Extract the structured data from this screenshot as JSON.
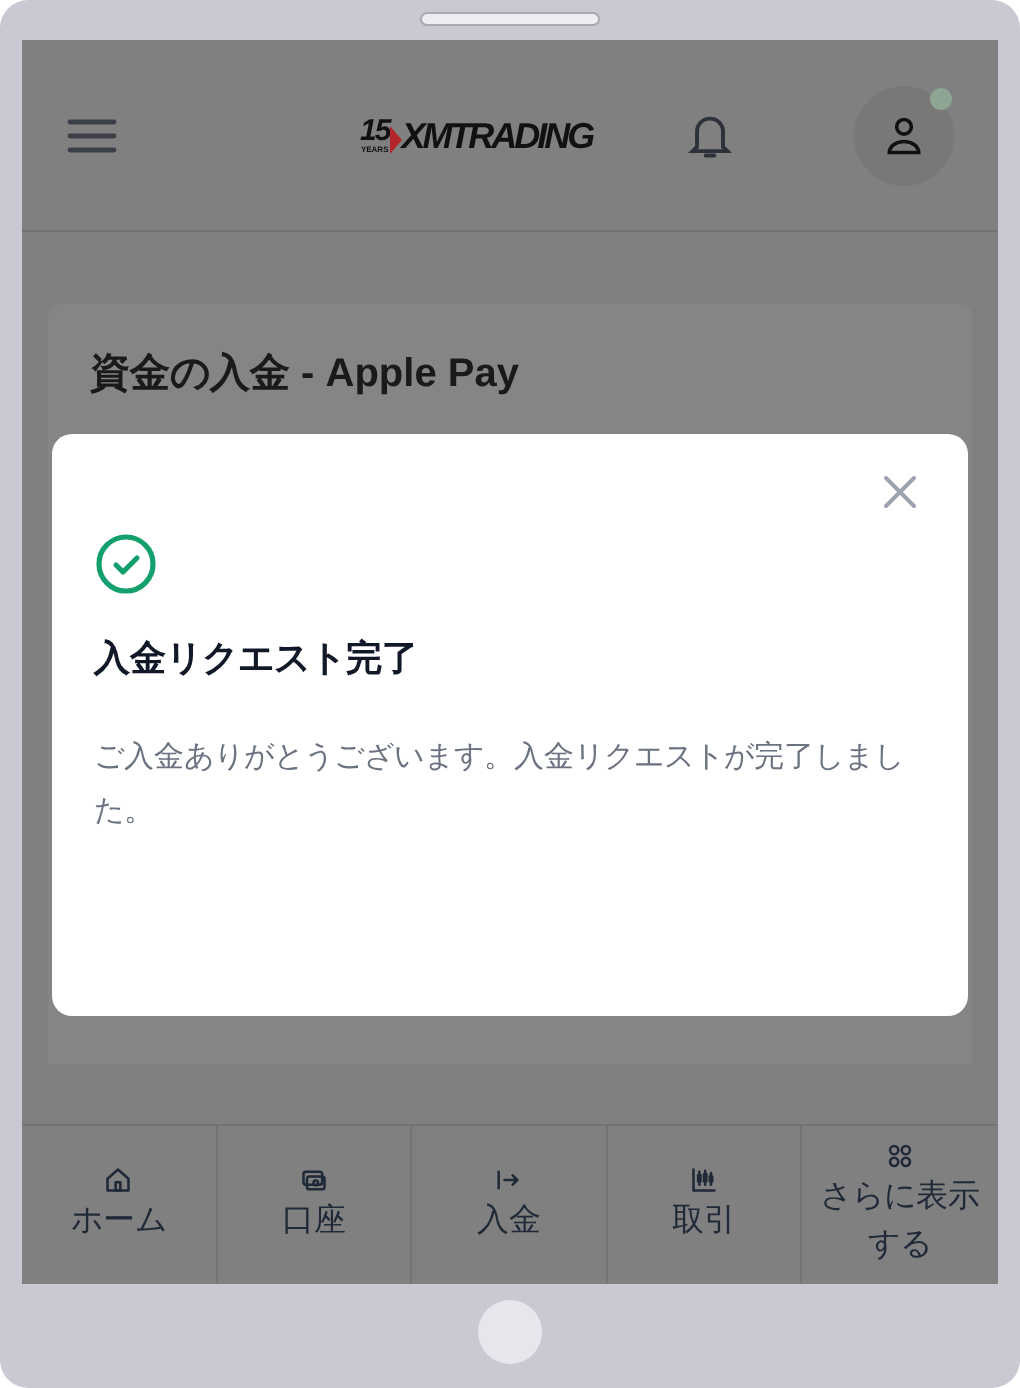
{
  "header": {
    "logo": {
      "number": "15",
      "years": "YEARS",
      "brand": "XMTRADING"
    },
    "notification_dot": true
  },
  "page": {
    "title": "資金の入金 - Apple Pay"
  },
  "modal": {
    "title": "入金リクエスト完了",
    "message": "ご入金ありがとうございます。入金リクエストが完了しました。"
  },
  "bottom_nav": [
    {
      "kind": "home",
      "label": "ホーム"
    },
    {
      "kind": "account",
      "label": "口座"
    },
    {
      "kind": "deposit",
      "label": "入金"
    },
    {
      "kind": "trade",
      "label": "取引"
    },
    {
      "kind": "more",
      "label": "さらに表示する"
    }
  ]
}
